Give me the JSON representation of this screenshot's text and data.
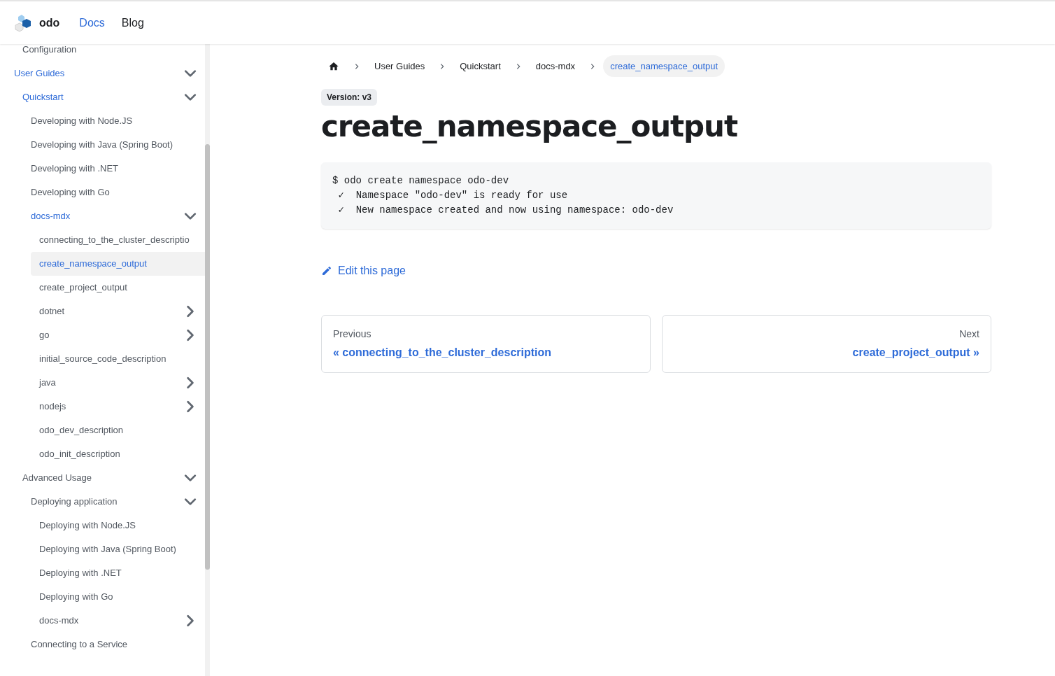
{
  "navbar": {
    "brand": "odo",
    "links": [
      {
        "label": "Docs",
        "selected": true
      },
      {
        "label": "Blog",
        "selected": false
      }
    ]
  },
  "sidebar": {
    "items_above": [
      {
        "label": "Configuration",
        "active": false
      }
    ],
    "items": [
      {
        "label": "User Guides",
        "active": true,
        "expanded": true,
        "children": [
          {
            "label": "Quickstart",
            "active": true,
            "expanded": true,
            "children": [
              {
                "label": "Developing with Node.JS",
                "active": false
              },
              {
                "label": "Developing with Java (Spring Boot)",
                "active": false
              },
              {
                "label": "Developing with .NET",
                "active": false
              },
              {
                "label": "Developing with Go",
                "active": false
              },
              {
                "label": "docs-mdx",
                "active": true,
                "expanded": true,
                "children": [
                  {
                    "label": "connecting_to_the_cluster_descriptio",
                    "active": false,
                    "selected": false
                  },
                  {
                    "label": "create_namespace_output",
                    "active": true,
                    "selected": true
                  },
                  {
                    "label": "create_project_output",
                    "active": false,
                    "selected": false
                  },
                  {
                    "label": "dotnet",
                    "active": false,
                    "selected": false,
                    "expanded": false
                  },
                  {
                    "label": "go",
                    "active": false,
                    "selected": false,
                    "expanded": false
                  },
                  {
                    "label": "initial_source_code_description",
                    "active": false,
                    "selected": false
                  },
                  {
                    "label": "java",
                    "active": false,
                    "selected": false,
                    "expanded": false
                  },
                  {
                    "label": "nodejs",
                    "active": false,
                    "selected": false,
                    "expanded": false
                  },
                  {
                    "label": "odo_dev_description",
                    "active": false,
                    "selected": false
                  },
                  {
                    "label": "odo_init_description",
                    "active": false,
                    "selected": false
                  }
                ]
              }
            ]
          },
          {
            "label": "Advanced Usage",
            "active": false,
            "expanded": true,
            "children": [
              {
                "label": "Deploying application",
                "active": false,
                "expanded": true,
                "children": [
                  {
                    "label": "Deploying with Node.JS",
                    "active": false
                  },
                  {
                    "label": "Deploying with Java (Spring Boot)",
                    "active": false
                  },
                  {
                    "label": "Deploying with .NET",
                    "active": false
                  },
                  {
                    "label": "Deploying with Go",
                    "active": false
                  },
                  {
                    "label": "docs-mdx",
                    "active": false,
                    "expanded": false
                  }
                ]
              },
              {
                "label": "Connecting to a Service",
                "active": false
              }
            ]
          }
        ]
      }
    ]
  },
  "breadcrumbs": [
    {
      "label": "User Guides",
      "selected": false
    },
    {
      "label": "Quickstart",
      "selected": false
    },
    {
      "label": "docs-mdx",
      "selected": false
    },
    {
      "label": "create_namespace_output",
      "selected": true
    }
  ],
  "version_badge": "Version: v3",
  "title": "create_namespace_output",
  "code_block": [
    "$ odo create namespace odo-dev",
    " ✓  Namespace \"odo-dev\" is ready for use",
    " ✓  New namespace created and now using namespace: odo-dev"
  ],
  "edit_link": "Edit this page",
  "pagination": {
    "previous": {
      "caption": "Previous",
      "label": "« connecting_to_the_cluster_description"
    },
    "next": {
      "caption": "Next",
      "label": "create_project_output »"
    }
  }
}
